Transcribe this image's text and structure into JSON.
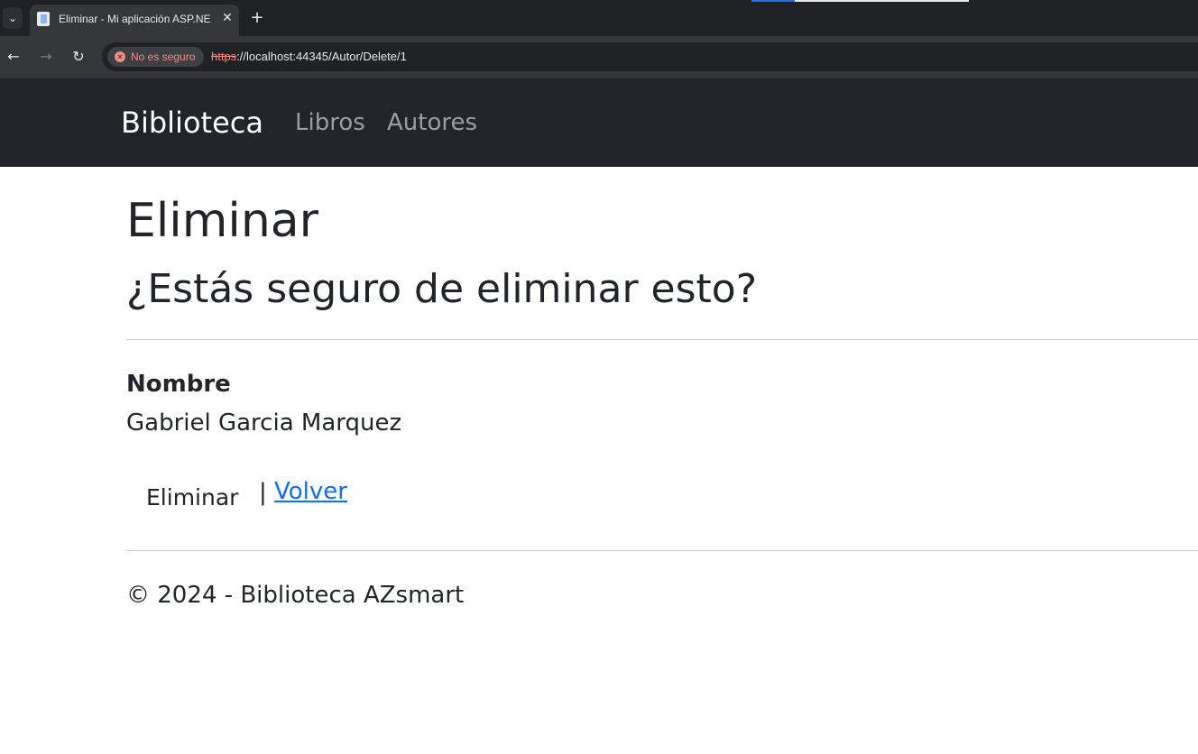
{
  "browser": {
    "tab": {
      "title": "Eliminar - Mi aplicación ASP.NET",
      "close_glyph": "✕"
    },
    "new_tab_glyph": "+",
    "tab_search_glyph": "⌄",
    "nav": {
      "back_glyph": "←",
      "forward_glyph": "→",
      "reload_glyph": "↻"
    },
    "security": {
      "label": "No es seguro",
      "icon_glyph": "×"
    },
    "url": {
      "scheme": "https",
      "rest": "://localhost:44345/Autor/Delete/1"
    }
  },
  "navbar": {
    "brand": "Biblioteca",
    "links": [
      "Libros",
      "Autores"
    ]
  },
  "page": {
    "title": "Eliminar",
    "question": "¿Estás seguro de eliminar esto?",
    "field_label": "Nombre",
    "field_value": "Gabriel Garcia Marquez",
    "delete_button": "Eliminar",
    "separator": "|",
    "back_link": "Volver",
    "footer": "© 2024 - Biblioteca AZsmart"
  },
  "colors": {
    "navbar_bg": "#212529",
    "link": "#0d6efd",
    "insecure": "#f28b82"
  }
}
